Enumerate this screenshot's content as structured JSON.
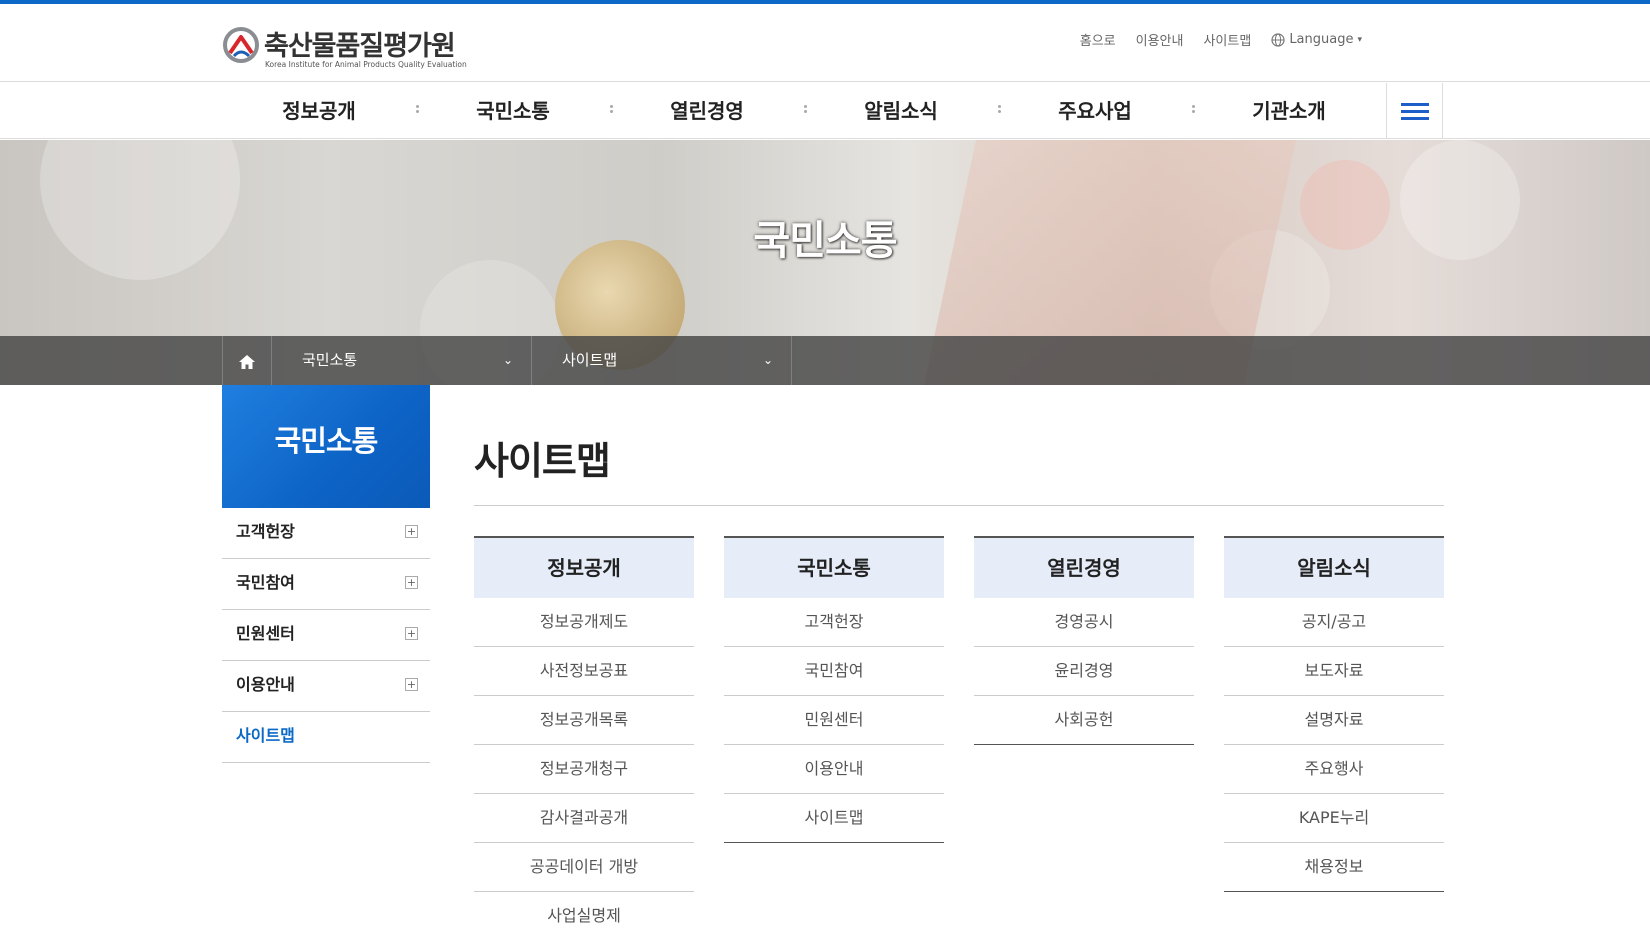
{
  "colors": {
    "brand_blue": "#0c69c7",
    "nav_icon_blue": "#1e5ec8",
    "column_head_bg": "#e6ecf8"
  },
  "logo": {
    "name": "축산물품질평가원",
    "sub": "Korea Institute for Animal Products Quality Evaluation"
  },
  "util": {
    "home": "홈으로",
    "guide": "이용안내",
    "sitemap": "사이트맵",
    "language": "Language"
  },
  "gnb": [
    "정보공개",
    "국민소통",
    "열린경영",
    "알림소식",
    "주요사업",
    "기관소개"
  ],
  "visual": {
    "title": "국민소통"
  },
  "location": {
    "depth1": "국민소통",
    "depth2": "사이트맵"
  },
  "side": {
    "title": "국민소통",
    "items": [
      {
        "label": "고객헌장",
        "expandable": true
      },
      {
        "label": "국민참여",
        "expandable": true
      },
      {
        "label": "민원센터",
        "expandable": true
      },
      {
        "label": "이용안내",
        "expandable": true
      },
      {
        "label": "사이트맵",
        "expandable": false,
        "active": true
      }
    ]
  },
  "page": {
    "title": "사이트맵"
  },
  "sitemap": [
    {
      "title": "정보공개",
      "items": [
        "정보공개제도",
        "사전정보공표",
        "정보공개목록",
        "정보공개청구",
        "감사결과공개",
        "공공데이터 개방",
        "사업실명제"
      ]
    },
    {
      "title": "국민소통",
      "items": [
        "고객헌장",
        "국민참여",
        "민원센터",
        "이용안내",
        "사이트맵"
      ]
    },
    {
      "title": "열린경영",
      "items": [
        "경영공시",
        "윤리경영",
        "사회공헌"
      ]
    },
    {
      "title": "알림소식",
      "items": [
        "공지/공고",
        "보도자료",
        "설명자료",
        "주요행사",
        "KAPE누리",
        "채용정보"
      ]
    }
  ]
}
